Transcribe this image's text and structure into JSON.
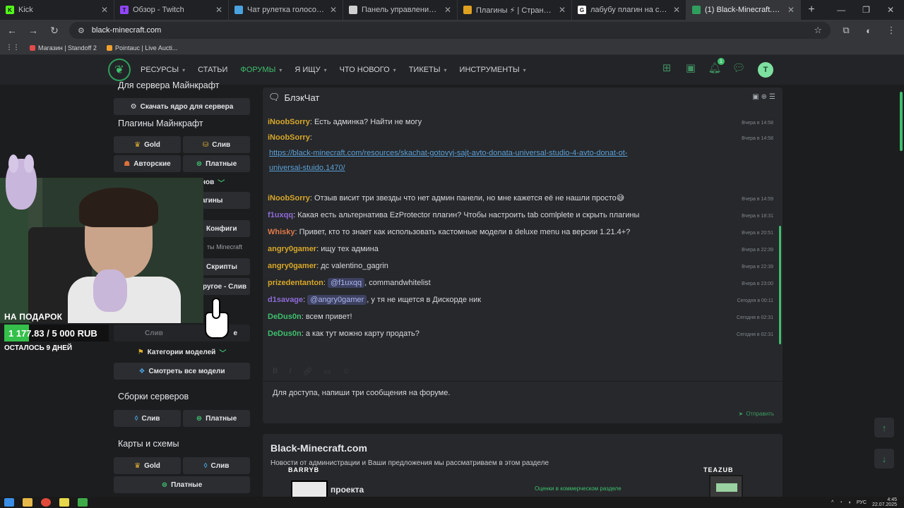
{
  "browser": {
    "tabs": [
      {
        "label": "Kick",
        "favicon": "#53fc18",
        "letter": "K",
        "active": false
      },
      {
        "label": "Обзор - Twitch",
        "favicon": "#9146ff",
        "letter": "T",
        "active": false
      },
      {
        "label": "Чат рулетка голосовая — Nek",
        "favicon": "#4aa3df",
        "letter": "",
        "active": false
      },
      {
        "label": "Панель управления Майнкра",
        "favicon": "#d0d0d0",
        "letter": "",
        "active": false
      },
      {
        "label": "Плагины ⚡ | Страница 2 | 🔥",
        "favicon": "#e0a020",
        "letter": "",
        "active": false
      },
      {
        "label": "лабубу плагин на сервер май",
        "favicon": "#ffffff",
        "letter": "G",
        "active": false
      },
      {
        "label": "(1) Black-Minecraft.com — лучш",
        "favicon": "#2f9e5c",
        "letter": "",
        "active": true
      }
    ],
    "url": "black-minecraft.com",
    "bookmarks": [
      {
        "label": "Магазин | Standoff 2",
        "color": "#e14b4b"
      },
      {
        "label": "Pointauc | Live Aucti...",
        "color": "#f0a030"
      }
    ]
  },
  "site": {
    "nav": [
      {
        "label": "РЕСУРСЫ",
        "caret": true,
        "current": false
      },
      {
        "label": "СТАТЬИ",
        "caret": false,
        "current": false
      },
      {
        "label": "ФОРУМЫ",
        "caret": true,
        "current": true
      },
      {
        "label": "Я ИЩУ",
        "caret": true,
        "current": false
      },
      {
        "label": "ЧТО НОВОГО",
        "caret": true,
        "current": false
      },
      {
        "label": "ТИКЕТЫ",
        "caret": true,
        "current": false
      },
      {
        "label": "ИНСТРУМЕНТЫ",
        "caret": true,
        "current": false
      }
    ],
    "alerts_count": "1",
    "avatar_letter": "T",
    "accent": "#3fbf6e"
  },
  "sidebar": {
    "server_title": "Для сервера Майнкрафт",
    "download_core": "Скачать ядро для сервера",
    "plugins_title": "Плагины Майнкрафт",
    "plugins_gold": "Gold",
    "plugins_leak": "Слив",
    "plugins_author": "Авторские",
    "plugins_paid": "Платные",
    "plugins_partial_1": "нов",
    "plugins_partial_2": "агины",
    "configs": "Конфиги",
    "worlds_partial": "ты Minecraft",
    "scripts": "Скрипты",
    "other_leak": "ругое - Слив",
    "models_leak": "Слив",
    "models_partial": "е",
    "model_categories": "Категории моделей",
    "all_models": "Смотреть все модели",
    "builds_title": "Сборки серверов",
    "builds_leak": "Слив",
    "builds_paid": "Платные",
    "maps_title": "Карты и схемы",
    "maps_gold": "Gold",
    "maps_leak": "Слив",
    "maps_paid": "Платные"
  },
  "stream_overlay": {
    "gift_label": "НА ПОДАРОК",
    "raised": "1 177.83",
    "goal": "/ 5 000 RUB",
    "progress": 0.2356,
    "days_left": "ОСТАЛОСЬ 9 ДНЕЙ"
  },
  "chat": {
    "title": "БлэкЧат",
    "messages": [
      {
        "user": "iNoobSorry",
        "color": "#d8a72a",
        "text": "Есть админка? Найти не могу",
        "time": "Вчера в 14:58"
      },
      {
        "user": "iNoobSorry",
        "color": "#d8a72a",
        "text": "",
        "time": "Вчера в 14:58",
        "link": "https://black-minecraft.com/resources/skachat-gotovyj-sajt-avto-donata-universal-studio-4-avto-donat-ot-",
        "link2": "universal-stuido.1470/"
      },
      {
        "user": "iNoobSorry",
        "color": "#d8a72a",
        "text": "Отзыв висит три звезды что нет админ панели, но мне кажется её не нашли просто😅",
        "time": "Вчера в 14:59"
      },
      {
        "user": "f1uxqq",
        "color": "#8e6bd8",
        "text": "Какая есть альтернатива EzProtector плагин? Чтобы настроить tab comlplete и скрыть плагины",
        "time": "Вчера в 18:31"
      },
      {
        "user": "Whisky",
        "color": "#e0794a",
        "text": "Привет, кто то знает как использовать кастомные модели в deluxe menu на версии 1.21.4+?",
        "time": "Вчера в 20:51"
      },
      {
        "user": "angry0gamer",
        "color": "#d8a72a",
        "text": "ищу тех админа",
        "time": "Вчера в 22:39"
      },
      {
        "user": "angry0gamer",
        "color": "#d8a72a",
        "text": "дс valentino_gagrin",
        "time": "Вчера в 22:39"
      },
      {
        "user": "prizedentanton",
        "color": "#d8a72a",
        "text": ", commandwhitelist",
        "mention": "@f1uxqq",
        "time": "Вчера в 23:00"
      },
      {
        "user": "d1savage",
        "color": "#8e6bd8",
        "text": ", у тя не ищется в Дискорде ник",
        "mention": "@angry0gamer",
        "time": "Сегодня в 00:11"
      },
      {
        "user": "DeDus0n",
        "color": "#3fbf6e",
        "text": "всем привет!",
        "time": "Сегодня в 02:31"
      },
      {
        "user": "DeDus0n",
        "color": "#3fbf6e",
        "text": "а как тут можно карту продать?",
        "time": "Сегодня в 02:31"
      }
    ],
    "notice": "Для доступа, напиши три сообщения на форуме.",
    "send_label": "Отправить"
  },
  "news": {
    "title": "Black-Minecraft.com",
    "desc": "Новости от администрации и Ваши предложения мы рассматриваем в этом разделе",
    "project": "проекта",
    "ratings": "Оценки в коммерческом разделе",
    "nick1": "BARRYB",
    "nick2": "TEAZUB"
  },
  "taskbar": {
    "lang": "РУС",
    "time": "4:45",
    "date": "22.07.2025"
  }
}
